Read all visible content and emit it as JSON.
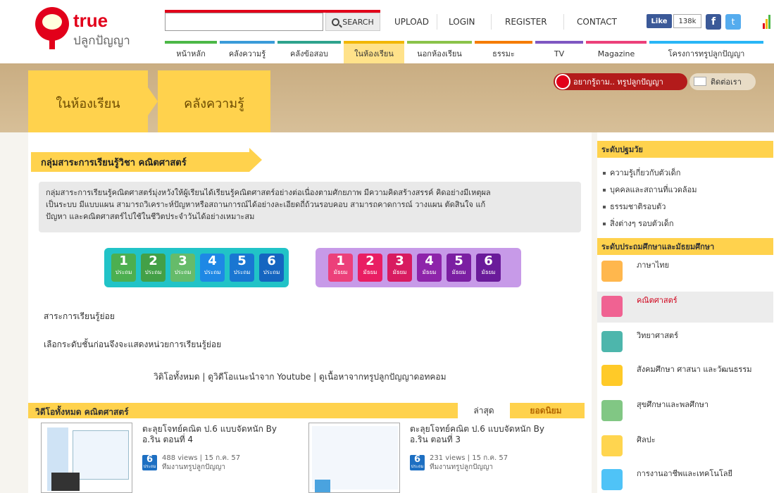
{
  "header": {
    "logo_brand": "true",
    "logo_sub": "ปลูกปัญญา",
    "search_label": "SEARCH",
    "links": [
      "UPLOAD",
      "LOGIN",
      "REGISTER",
      "CONTACT"
    ],
    "fb_like": "Like",
    "fb_count": "138k",
    "fb_glyph": "f",
    "tw_glyph": "t"
  },
  "nav": {
    "tabs": [
      {
        "label": "หน้าหลัก",
        "color": "#4cb847"
      },
      {
        "label": "คลังความรู้",
        "color": "#3a9bd9"
      },
      {
        "label": "คลังข้อสอบ",
        "color": "#2ea38d"
      },
      {
        "label": "ในห้องเรียน",
        "color": "#f2b705"
      },
      {
        "label": "นอกห้องเรียน",
        "color": "#8bc34a"
      },
      {
        "label": "ธรรมะ",
        "color": "#f57c00"
      },
      {
        "label": "TV",
        "color": "#7e57c2"
      },
      {
        "label": "Magazine",
        "color": "#ec407a"
      },
      {
        "label": "โครงการทรูปลูกปัญญา",
        "color": "#29b6f6"
      }
    ]
  },
  "breadcrumb": {
    "first": "ในห้องเรียน",
    "second": "คลังความรู้"
  },
  "banner_buttons": {
    "ask": "อยากรู้ถาม.. ทรูปลูกปัญญา",
    "contact": "ติดต่อเรา"
  },
  "subject": {
    "heading": "กลุ่มสาระการเรียนรู้วิชา คณิตศาสตร์",
    "desc1": "กลุ่มสาระการเรียนรู้คณิตศาสตร์มุ่งหวังให้ผู้เรียนได้เรียนรู้คณิตศาสตร์อย่างต่อเนื่องตามศักยภาพ มีความคิดสร้างสรรค์ คิดอย่างมีเหตุผล",
    "desc2": "เป็นระบบ มีแบบแผน สามารถวิเคราะห์ปัญหาหรือสถานการณ์ได้อย่างละเอียดถี่ถ้วนรอบคอบ สามารถคาดการณ์ วางแผน ตัดสินใจ แก้",
    "desc3": "ปัญหา และคณิตศาสตร์ไปใช้ในชีวิตประจำวันได้อย่างเหมาะสม"
  },
  "levels": {
    "primary": [
      {
        "num": "1",
        "label": "ประถม",
        "color": "#4caf50"
      },
      {
        "num": "2",
        "label": "ประถม",
        "color": "#43a047"
      },
      {
        "num": "3",
        "label": "ประถม",
        "color": "#66bb6a"
      },
      {
        "num": "4",
        "label": "ประถม",
        "color": "#1e88e5"
      },
      {
        "num": "5",
        "label": "ประถม",
        "color": "#1976d2"
      },
      {
        "num": "6",
        "label": "ประถม",
        "color": "#1565c0"
      }
    ],
    "secondary": [
      {
        "num": "1",
        "label": "มัธยม",
        "color": "#ec407a"
      },
      {
        "num": "2",
        "label": "มัธยม",
        "color": "#e91e63"
      },
      {
        "num": "3",
        "label": "มัธยม",
        "color": "#d81b60"
      },
      {
        "num": "4",
        "label": "มัธยม",
        "color": "#8e24aa"
      },
      {
        "num": "5",
        "label": "มัธยม",
        "color": "#7b1fa2"
      },
      {
        "num": "6",
        "label": "มัธยม",
        "color": "#6a1b9a"
      }
    ]
  },
  "sub_strands": {
    "title": "สาระการเรียนรู้ย่อย",
    "hint": "เลือกระดับชั้นก่อนจึงจะแสดงหน่วยการเรียนรู้ย่อย"
  },
  "video_links": "วิดิโอทั้งหมด | ดูวิดีโอแนะนำจาก Youtube | ดูเนื้อหาจากทรูปลูกปัญญาดอทคอม",
  "videos_section": {
    "title": "วิดีโอทั้งหมด คณิตศาสตร์",
    "tab_latest": "ล่าสุด",
    "tab_popular": "ยอดนิยม",
    "items": [
      {
        "title": "ตะลุยโจทย์คณิต ป.6 แบบจัดหนัก By อ.ริน ตอนที่ 4",
        "badge_num": "6",
        "badge_label": "ประถม",
        "views": "488 views | 15 ก.ค. 57",
        "team": "ทีมงานทรูปลูกปัญญา"
      },
      {
        "title": "ตะลุยโจทย์คณิต ป.6 แบบจัดหนัก By อ.ริน ตอนที่ 3",
        "badge_num": "6",
        "badge_label": "ประถม",
        "views": "231 views | 15 ก.ค. 57",
        "team": "ทีมงานทรูปลูกปัญญา"
      }
    ]
  },
  "sidebar": {
    "early_title": "ระดับปฐมวัย",
    "early_items": [
      "ความรู้เกี่ยวกับตัวเด็ก",
      "บุคคลและสถานที่แวดล้อม",
      "ธรรมชาติรอบตัว",
      "สิ่งต่างๆ รอบตัวเด็ก"
    ],
    "school_title": "ระดับประถมศึกษาและมัธยมศึกษา",
    "subjects": [
      {
        "label": "ภาษาไทย",
        "icon": "thai-language-icon"
      },
      {
        "label": "คณิตศาสตร์",
        "icon": "math-icon"
      },
      {
        "label": "วิทยาศาสตร์",
        "icon": "science-icon"
      },
      {
        "label": "สังคมศึกษา ศาสนา และวัฒนธรรม",
        "icon": "social-studies-icon"
      },
      {
        "label": "สุขศึกษาและพลศึกษา",
        "icon": "health-pe-icon"
      },
      {
        "label": "ศิลปะ",
        "icon": "art-icon"
      },
      {
        "label": "การงานอาชีพและเทคโนโลยี",
        "icon": "career-tech-icon"
      }
    ]
  }
}
